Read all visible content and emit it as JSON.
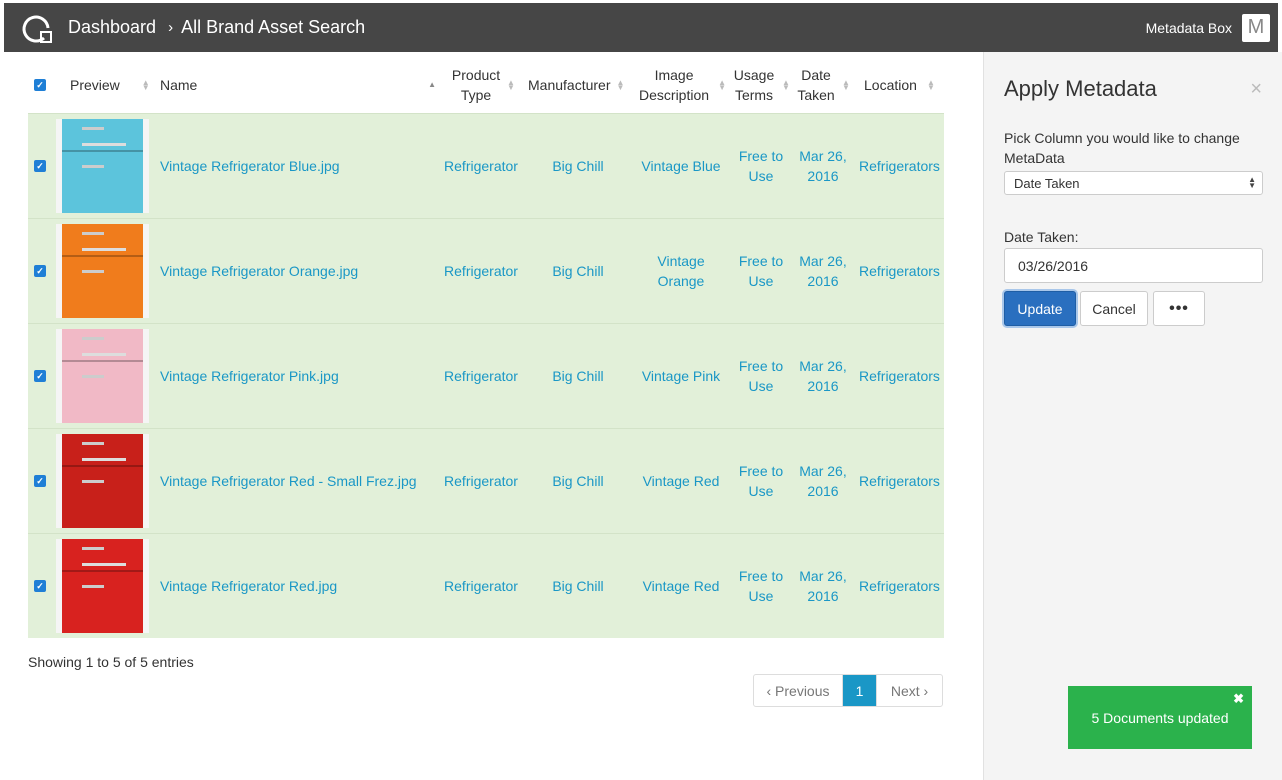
{
  "header": {
    "crumbs": [
      "Dashboard",
      "All Brand Asset Search"
    ],
    "separator": "›",
    "app_name": "Metadata Box",
    "avatar_letter": "M"
  },
  "table": {
    "columns": [
      "Preview",
      "Name",
      "Product Type",
      "Manufacturer",
      "Image Description",
      "Usage Terms",
      "Date Taken",
      "Location"
    ],
    "rows": [
      {
        "name": "Vintage Refrigerator Blue.jpg",
        "product_type": "Refrigerator",
        "manufacturer": "Big Chill",
        "description": "Vintage Blue",
        "usage": "Free to Use",
        "date": "Mar 26, 2016",
        "location": "Refrigerators",
        "color": "#5cc4dc"
      },
      {
        "name": "Vintage Refrigerator Orange.jpg",
        "product_type": "Refrigerator",
        "manufacturer": "Big Chill",
        "description": "Vintage Orange",
        "usage": "Free to Use",
        "date": "Mar 26, 2016",
        "location": "Refrigerators",
        "color": "#f07c1c"
      },
      {
        "name": "Vintage Refrigerator Pink.jpg",
        "product_type": "Refrigerator",
        "manufacturer": "Big Chill",
        "description": "Vintage Pink",
        "usage": "Free to Use",
        "date": "Mar 26, 2016",
        "location": "Refrigerators",
        "color": "#f1b9c6"
      },
      {
        "name": "Vintage Refrigerator Red - Small Frez.jpg",
        "product_type": "Refrigerator",
        "manufacturer": "Big Chill",
        "description": "Vintage Red",
        "usage": "Free to Use",
        "date": "Mar 26, 2016",
        "location": "Refrigerators",
        "color": "#c8201a"
      },
      {
        "name": "Vintage Refrigerator Red.jpg",
        "product_type": "Refrigerator",
        "manufacturer": "Big Chill",
        "description": "Vintage Red",
        "usage": "Free to Use",
        "date": "Mar 26, 2016",
        "location": "Refrigerators",
        "color": "#d8221f"
      }
    ]
  },
  "footer": {
    "info": "Showing 1 to 5 of 5 entries",
    "prev": "‹ Previous",
    "page": "1",
    "next": "Next ›"
  },
  "panel": {
    "title": "Apply Metadata",
    "close": "×",
    "pick_label": "Pick Column you would like to change MetaData",
    "select_value": "Date Taken",
    "field_label": "Date Taken:",
    "field_value": "03/26/2016",
    "update": "Update",
    "cancel": "Cancel",
    "more": "•••"
  },
  "toast": {
    "message": "5 Documents updated",
    "close": "✖"
  },
  "colors": {
    "topbar": "#464646",
    "link": "#1a97c6",
    "row_bg": "#e2f0d9",
    "toast": "#2bb24c",
    "primary": "#2a6fbf"
  }
}
